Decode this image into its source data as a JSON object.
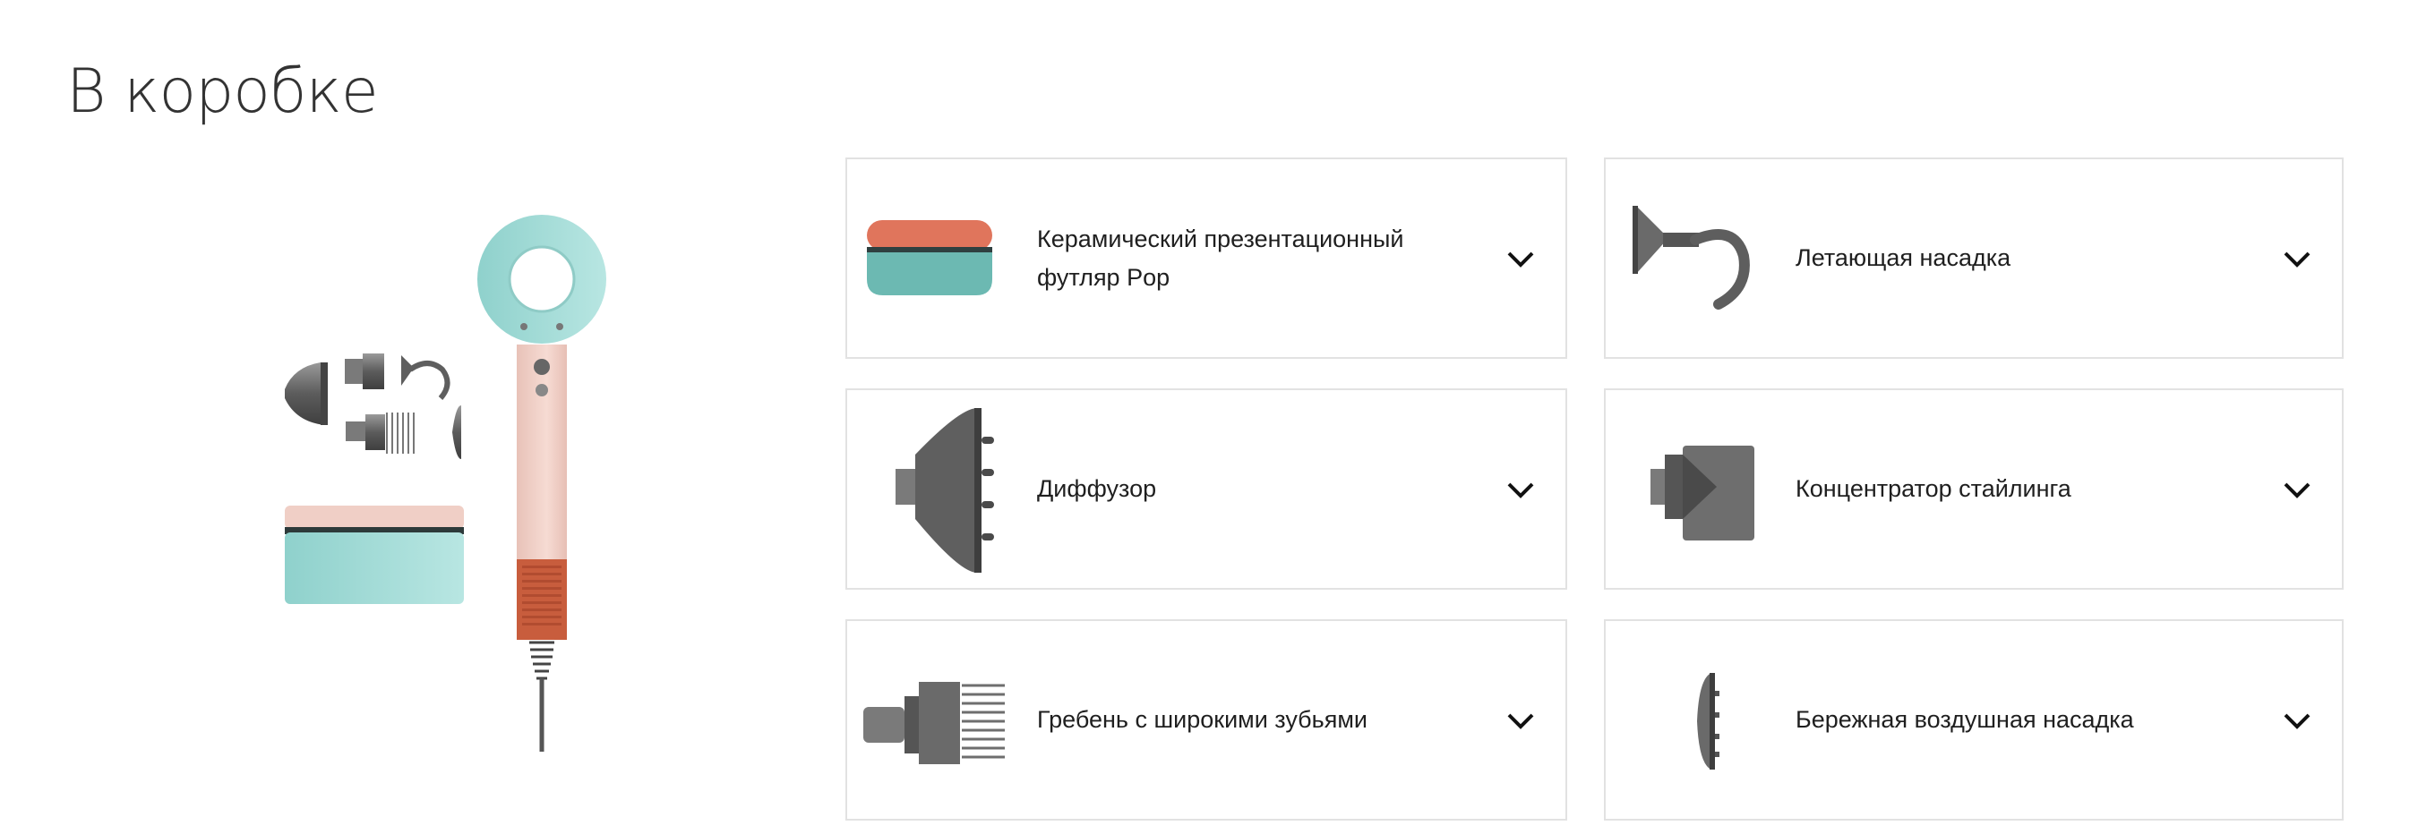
{
  "section": {
    "title": "В коробке"
  },
  "items": [
    {
      "label": "Керамический презентационный футляр Pop",
      "icon": "presentation-case-icon"
    },
    {
      "label": "Летающая насадка",
      "icon": "flyaway-attachment-icon"
    },
    {
      "label": "Диффузор",
      "icon": "diffuser-icon"
    },
    {
      "label": "Концентратор стайлинга",
      "icon": "styling-concentrator-icon"
    },
    {
      "label": "Гребень с широкими зубьями",
      "icon": "wide-tooth-comb-icon"
    },
    {
      "label": "Бережная воздушная насадка",
      "icon": "gentle-air-attachment-icon"
    }
  ],
  "colors": {
    "case_lid": "#e0755c",
    "case_base": "#6cb9b2",
    "dryer_head": "#a9dfdc",
    "dryer_handle": "#f0cfc6",
    "dryer_filter": "#c85d3d",
    "attachment_metal": "#6a6a6a",
    "border": "#e2e2e2"
  }
}
